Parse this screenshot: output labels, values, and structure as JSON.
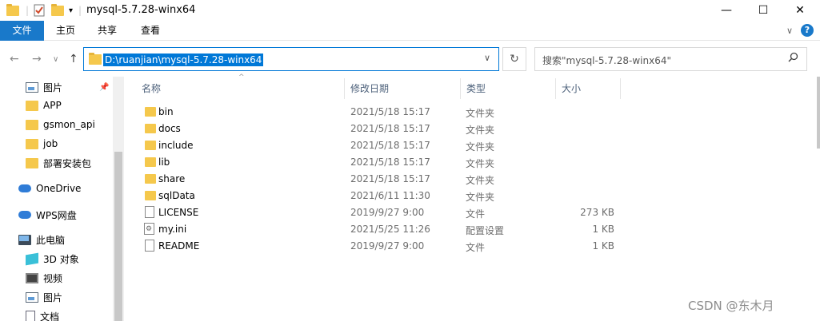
{
  "window": {
    "title": "mysql-5.7.28-winx64",
    "minimize": "—",
    "maximize": "☐",
    "close": "✕"
  },
  "ribbon": {
    "tabs": [
      "文件",
      "主页",
      "共享",
      "查看"
    ],
    "expand": "∨",
    "help": "?"
  },
  "address": {
    "path": "D:\\ruanjian\\mysql-5.7.28-winx64",
    "dropdown": "∨",
    "refresh": "↻"
  },
  "search": {
    "placeholder": "搜索\"mysql-5.7.28-winx64\"",
    "icon": "⚲"
  },
  "sidebar": {
    "items": [
      {
        "label": "图片",
        "icon": "pictures-icon"
      },
      {
        "label": "APP",
        "icon": "folder-icon"
      },
      {
        "label": "gsmon_api",
        "icon": "folder-icon"
      },
      {
        "label": "job",
        "icon": "folder-icon"
      },
      {
        "label": "部署安装包",
        "icon": "folder-icon"
      },
      {
        "label": "OneDrive",
        "icon": "cloud-icon"
      },
      {
        "label": "WPS网盘",
        "icon": "cloud-icon"
      },
      {
        "label": "此电脑",
        "icon": "computer-icon"
      },
      {
        "label": "3D 对象",
        "icon": "3d-objects-icon"
      },
      {
        "label": "视频",
        "icon": "video-icon"
      },
      {
        "label": "图片",
        "icon": "pictures-icon"
      },
      {
        "label": "文档",
        "icon": "documents-icon"
      }
    ]
  },
  "columns": {
    "name": "名称",
    "date": "修改日期",
    "type": "类型",
    "size": "大小",
    "sort_arrow": "^"
  },
  "files": [
    {
      "name": "bin",
      "date": "2021/5/18 15:17",
      "type": "文件夹",
      "size": "",
      "kind": "folder"
    },
    {
      "name": "docs",
      "date": "2021/5/18 15:17",
      "type": "文件夹",
      "size": "",
      "kind": "folder"
    },
    {
      "name": "include",
      "date": "2021/5/18 15:17",
      "type": "文件夹",
      "size": "",
      "kind": "folder"
    },
    {
      "name": "lib",
      "date": "2021/5/18 15:17",
      "type": "文件夹",
      "size": "",
      "kind": "folder"
    },
    {
      "name": "share",
      "date": "2021/5/18 15:17",
      "type": "文件夹",
      "size": "",
      "kind": "folder"
    },
    {
      "name": "sqlData",
      "date": "2021/6/11 11:30",
      "type": "文件夹",
      "size": "",
      "kind": "folder"
    },
    {
      "name": "LICENSE",
      "date": "2019/9/27 9:00",
      "type": "文件",
      "size": "273 KB",
      "kind": "file"
    },
    {
      "name": "my.ini",
      "date": "2021/5/25 11:26",
      "type": "配置设置",
      "size": "1 KB",
      "kind": "config"
    },
    {
      "name": "README",
      "date": "2019/9/27 9:00",
      "type": "文件",
      "size": "1 KB",
      "kind": "file"
    }
  ],
  "watermark": "CSDN @东木月"
}
